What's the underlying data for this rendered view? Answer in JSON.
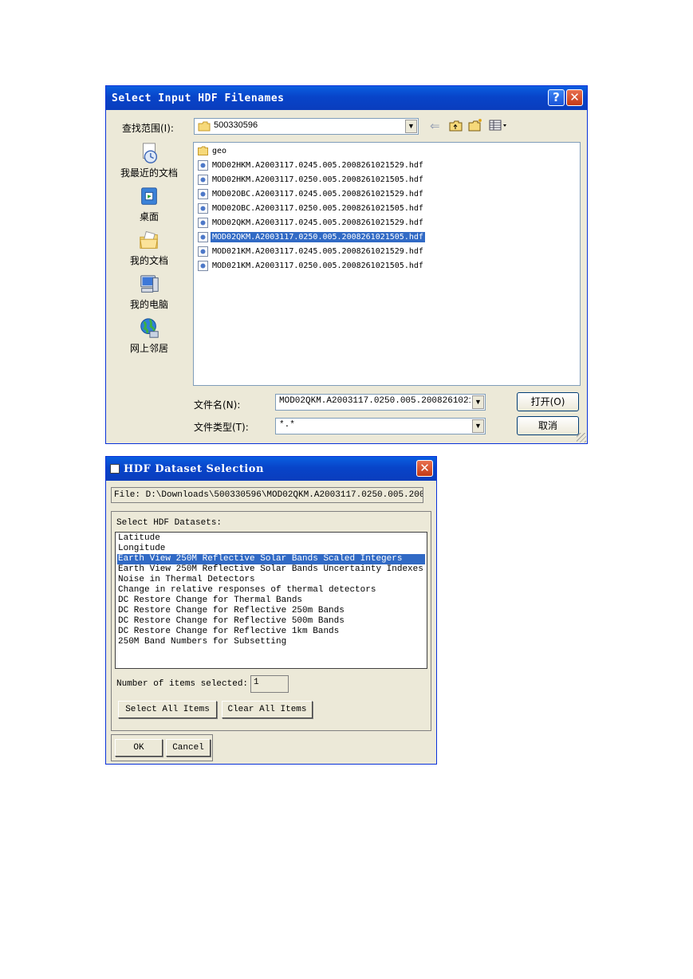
{
  "file_dialog": {
    "title": "Select Input HDF Filenames",
    "help_glyph": "?",
    "close_glyph": "✕",
    "lookin_label": "查找范围(I):",
    "lookin_value": "500330596",
    "toolbar": {
      "back_glyph": "⇐"
    },
    "places": [
      {
        "label": "我最近的文档",
        "icon": "recent-documents-icon"
      },
      {
        "label": "桌面",
        "icon": "desktop-icon"
      },
      {
        "label": "我的文档",
        "icon": "my-documents-icon"
      },
      {
        "label": "我的电脑",
        "icon": "my-computer-icon"
      },
      {
        "label": "网上邻居",
        "icon": "network-places-icon"
      }
    ],
    "files": [
      {
        "name": "geo",
        "type": "folder"
      },
      {
        "name": "MOD02HKM.A2003117.0245.005.2008261021529.hdf",
        "type": "file"
      },
      {
        "name": "MOD02HKM.A2003117.0250.005.2008261021505.hdf",
        "type": "file"
      },
      {
        "name": "MOD02OBC.A2003117.0245.005.2008261021529.hdf",
        "type": "file"
      },
      {
        "name": "MOD02OBC.A2003117.0250.005.2008261021505.hdf",
        "type": "file"
      },
      {
        "name": "MOD02QKM.A2003117.0245.005.2008261021529.hdf",
        "type": "file"
      },
      {
        "name": "MOD02QKM.A2003117.0250.005.2008261021505.hdf",
        "type": "file",
        "selected": true
      },
      {
        "name": "MOD021KM.A2003117.0245.005.2008261021529.hdf",
        "type": "file"
      },
      {
        "name": "MOD021KM.A2003117.0250.005.2008261021505.hdf",
        "type": "file"
      }
    ],
    "filename_label": "文件名(N):",
    "filename_value": "MOD02QKM.A2003117.0250.005.200826102150",
    "filetype_label": "文件类型(T):",
    "filetype_value": "*.*",
    "open_button": "打开(O)",
    "cancel_button": "取消"
  },
  "dataset_dialog": {
    "title": "HDF Dataset Selection",
    "close_glyph": "✕",
    "file_text": "File: D:\\Downloads\\500330596\\MOD02QKM.A2003117.0250.005.200",
    "group_label": "Select HDF Datasets:",
    "datasets": [
      {
        "name": "Latitude"
      },
      {
        "name": "Longitude"
      },
      {
        "name": "Earth View 250M Reflective Solar Bands Scaled Integers",
        "selected": true
      },
      {
        "name": "Earth View 250M Reflective Solar Bands Uncertainty Indexes"
      },
      {
        "name": "Noise in Thermal Detectors"
      },
      {
        "name": "Change in relative responses of thermal detectors"
      },
      {
        "name": "DC Restore Change for Thermal Bands"
      },
      {
        "name": "DC Restore Change for Reflective 250m Bands"
      },
      {
        "name": "DC Restore Change for Reflective 500m Bands"
      },
      {
        "name": "DC Restore Change for Reflective 1km Bands"
      },
      {
        "name": "250M Band Numbers for Subsetting"
      }
    ],
    "count_label": "Number of items selected:",
    "count_value": "1",
    "select_all_button": "Select All Items",
    "clear_all_button": "Clear All Items",
    "ok_button": "OK",
    "cancel_button": "Cancel"
  },
  "colors": {
    "titlebar": "#0a4fd6",
    "selection": "#316ac5",
    "dialog_bg": "#ece9d8",
    "close": "#d34a22"
  }
}
